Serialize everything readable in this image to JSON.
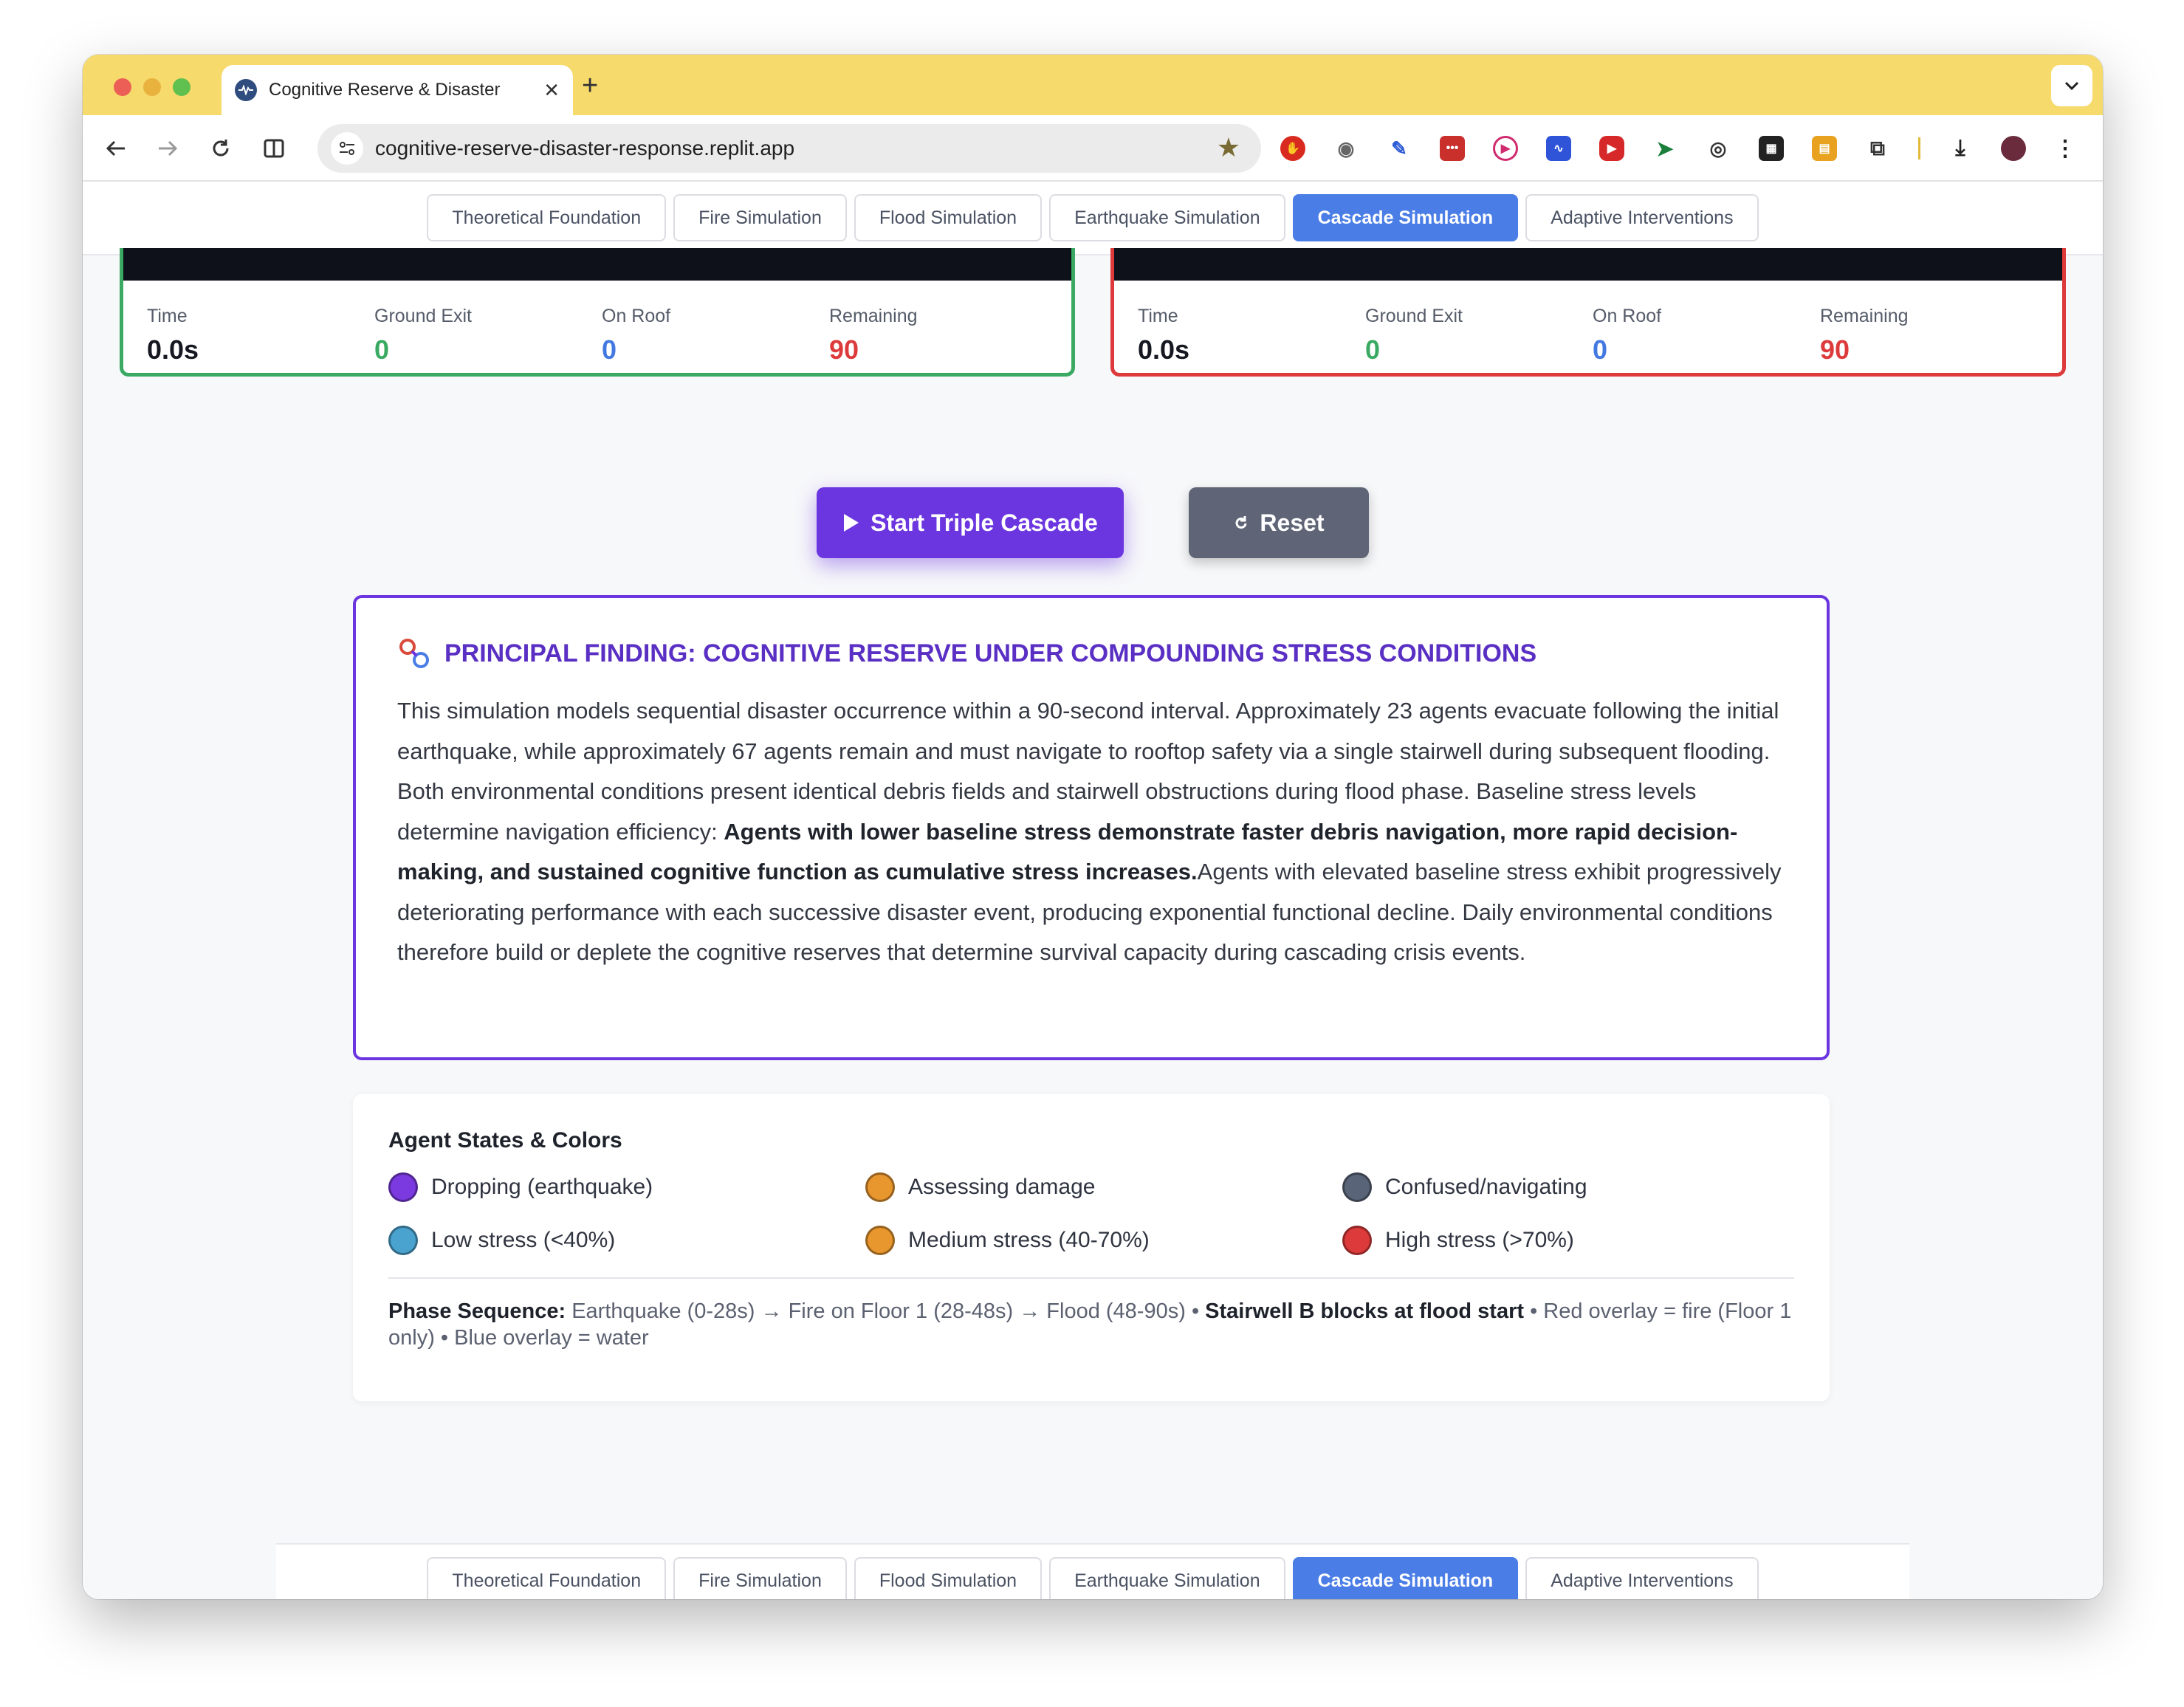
{
  "browser": {
    "tab_title": "Cognitive Reserve & Disaster",
    "url": "cognitive-reserve-disaster-response.replit.app"
  },
  "nav": {
    "tabs": [
      {
        "label": "Theoretical Foundation",
        "active": false
      },
      {
        "label": "Fire Simulation",
        "active": false
      },
      {
        "label": "Flood Simulation",
        "active": false
      },
      {
        "label": "Earthquake Simulation",
        "active": false
      },
      {
        "label": "Cascade Simulation",
        "active": true
      },
      {
        "label": "Adaptive Interventions",
        "active": false
      }
    ]
  },
  "panels": [
    {
      "border_color": "#3aaa63",
      "stats": [
        {
          "label": "Time",
          "value": "0.0s"
        },
        {
          "label": "Ground Exit",
          "value": "0"
        },
        {
          "label": "On Roof",
          "value": "0"
        },
        {
          "label": "Remaining",
          "value": "90"
        }
      ]
    },
    {
      "border_color": "#dd3b3b",
      "stats": [
        {
          "label": "Time",
          "value": "0.0s"
        },
        {
          "label": "Ground Exit",
          "value": "0"
        },
        {
          "label": "On Roof",
          "value": "0"
        },
        {
          "label": "Remaining",
          "value": "90"
        }
      ]
    }
  ],
  "controls": {
    "start_label": "Start Triple Cascade",
    "reset_label": "Reset"
  },
  "finding": {
    "title": "PRINCIPAL FINDING: COGNITIVE RESERVE UNDER COMPOUNDING STRESS CONDITIONS",
    "body_1": "This simulation models sequential disaster occurrence within a 90-second interval. Approximately 23 agents evacuate following the initial earthquake, while approximately 67 agents remain and must navigate to rooftop safety via a single stairwell during subsequent flooding. Both environmental conditions present identical debris fields and stairwell obstructions during flood phase. Baseline stress levels determine navigation efficiency: ",
    "body_bold": "Agents with lower baseline stress demonstrate faster debris navigation, more rapid decision-making, and sustained cognitive function as cumulative stress increases.",
    "body_2": "Agents with elevated baseline stress exhibit progressively deteriorating performance with each successive disaster event, producing exponential functional decline. Daily environmental conditions therefore build or deplete the cognitive reserves that determine survival capacity during cascading crisis events."
  },
  "legend": {
    "title": "Agent States & Colors",
    "items": [
      {
        "label": "Dropping (earthquake)",
        "color": "#7b3ae0"
      },
      {
        "label": "Assessing damage",
        "color": "#e8962e"
      },
      {
        "label": "Confused/navigating",
        "color": "#5a6478"
      },
      {
        "label": "Low stress (<40%)",
        "color": "#4aa3cf"
      },
      {
        "label": "Medium stress (40-70%)",
        "color": "#e8962e"
      },
      {
        "label": "High stress (>70%)",
        "color": "#dd3b3b"
      }
    ],
    "phase_label": "Phase Sequence:",
    "phase_text_1": " Earthquake (0-28s) → Fire on Floor 1 (28-48s) → Flood (48-90s) • ",
    "phase_bold": "Stairwell B blocks at flood start",
    "phase_text_2": " • Red overlay = fire (Floor 1 only) • Blue overlay = water"
  },
  "colors": {
    "accent_purple": "#6b35e0",
    "active_tab_blue": "#4a7de6",
    "chrome_yellow": "#f6da6b"
  }
}
